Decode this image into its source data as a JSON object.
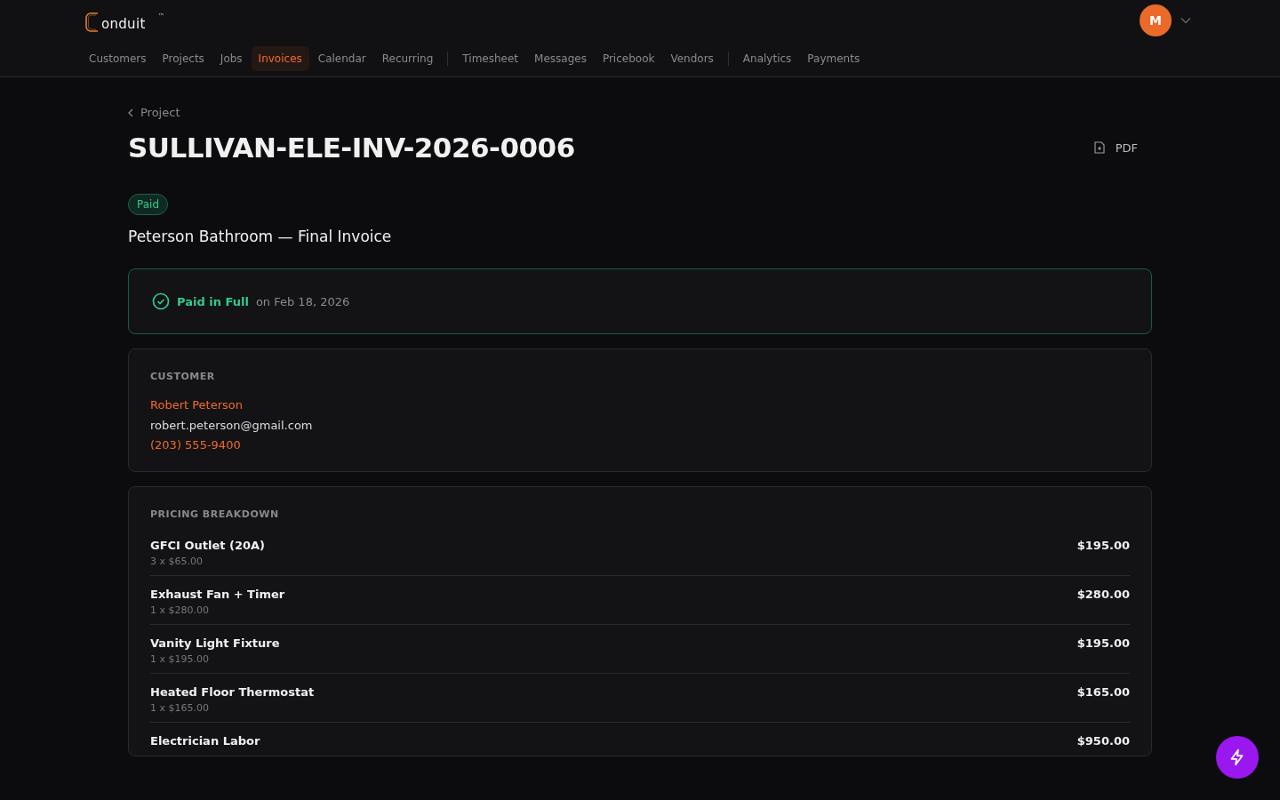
{
  "header": {
    "logo_text": "onduit",
    "trademark": "™",
    "avatar_initial": "M",
    "nav_groups": [
      [
        {
          "label": "Customers",
          "selected": false
        },
        {
          "label": "Projects",
          "selected": false
        },
        {
          "label": "Jobs",
          "selected": false
        },
        {
          "label": "Invoices",
          "selected": true
        },
        {
          "label": "Calendar",
          "selected": false
        },
        {
          "label": "Recurring",
          "selected": false
        }
      ],
      [
        {
          "label": "Timesheet",
          "selected": false
        },
        {
          "label": "Messages",
          "selected": false
        },
        {
          "label": "Pricebook",
          "selected": false
        },
        {
          "label": "Vendors",
          "selected": false
        }
      ],
      [
        {
          "label": "Analytics",
          "selected": false
        },
        {
          "label": "Payments",
          "selected": false
        }
      ]
    ]
  },
  "breadcrumb": "Project",
  "title": "SULLIVAN-ELE-INV-2026-0006",
  "pdf_button": "PDF",
  "status_badge": "Paid",
  "subtitle": "Peterson Bathroom — Final Invoice",
  "payment_banner": {
    "status": "Paid in Full",
    "date": "on Feb 18, 2026"
  },
  "customer": {
    "heading": "CUSTOMER",
    "name": "Robert Peterson",
    "email": "robert.peterson@gmail.com",
    "phone": "(203) 555-9400"
  },
  "pricing": {
    "heading": "PRICING BREAKDOWN",
    "items": [
      {
        "name": "GFCI Outlet (20A)",
        "detail": "3 x $65.00",
        "amount": "$195.00"
      },
      {
        "name": "Exhaust Fan + Timer",
        "detail": "1 x $280.00",
        "amount": "$280.00"
      },
      {
        "name": "Vanity Light Fixture",
        "detail": "1 x $195.00",
        "amount": "$195.00"
      },
      {
        "name": "Heated Floor Thermostat",
        "detail": "1 x $165.00",
        "amount": "$165.00"
      },
      {
        "name": "Electrician Labor",
        "amount": "$950.00"
      }
    ]
  }
}
